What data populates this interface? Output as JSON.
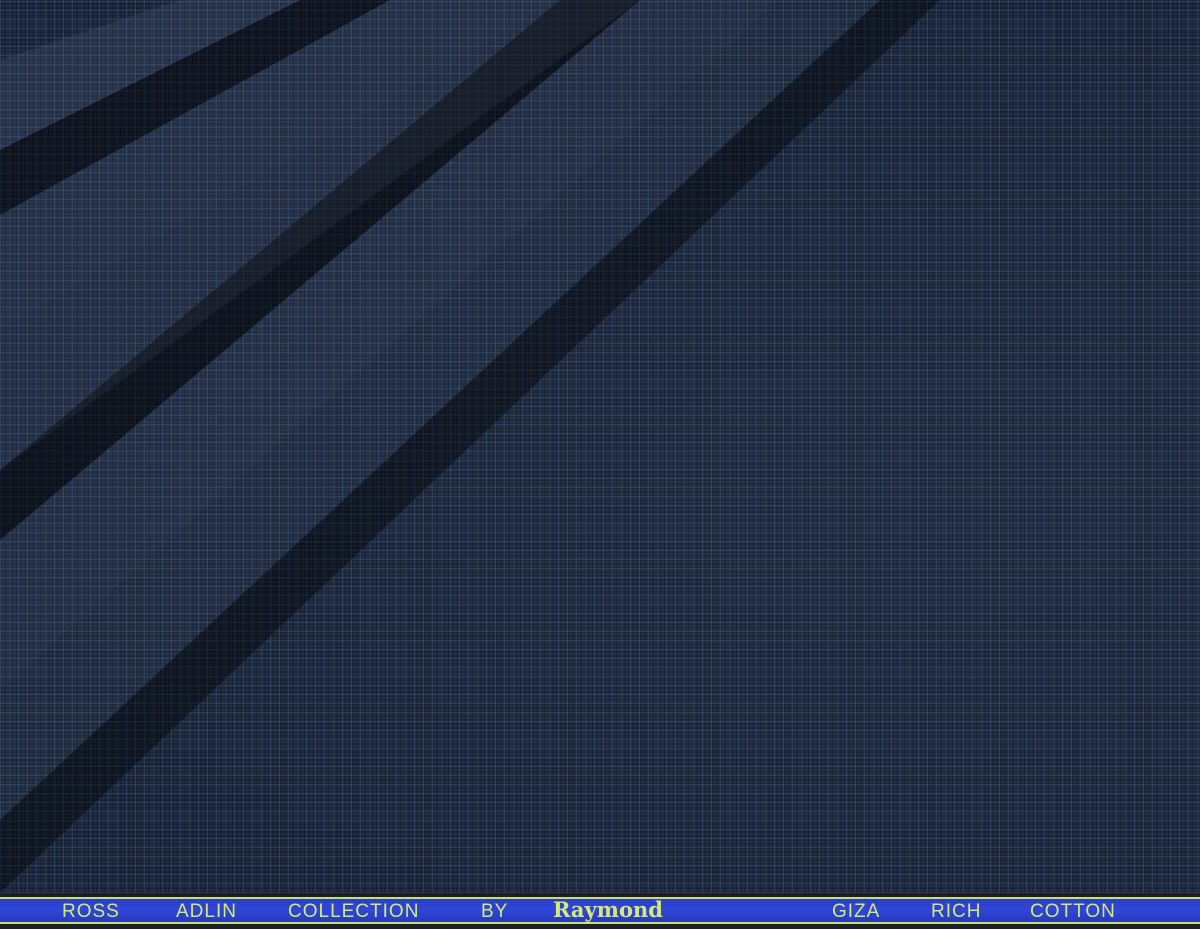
{
  "photo": {
    "subject": "navy checked suiting fabric, folded",
    "colors": {
      "base": "#26324a",
      "check_line": "#466eaa",
      "selvedge_band": "#2f46d8",
      "selvedge_text": "#d4ec73"
    }
  },
  "selvedge": {
    "words": [
      "ROSS",
      "ADLIN",
      "COLLECTION",
      "BY",
      "GIZA",
      "RICH",
      "COTTON"
    ],
    "brand": "Raymond"
  }
}
